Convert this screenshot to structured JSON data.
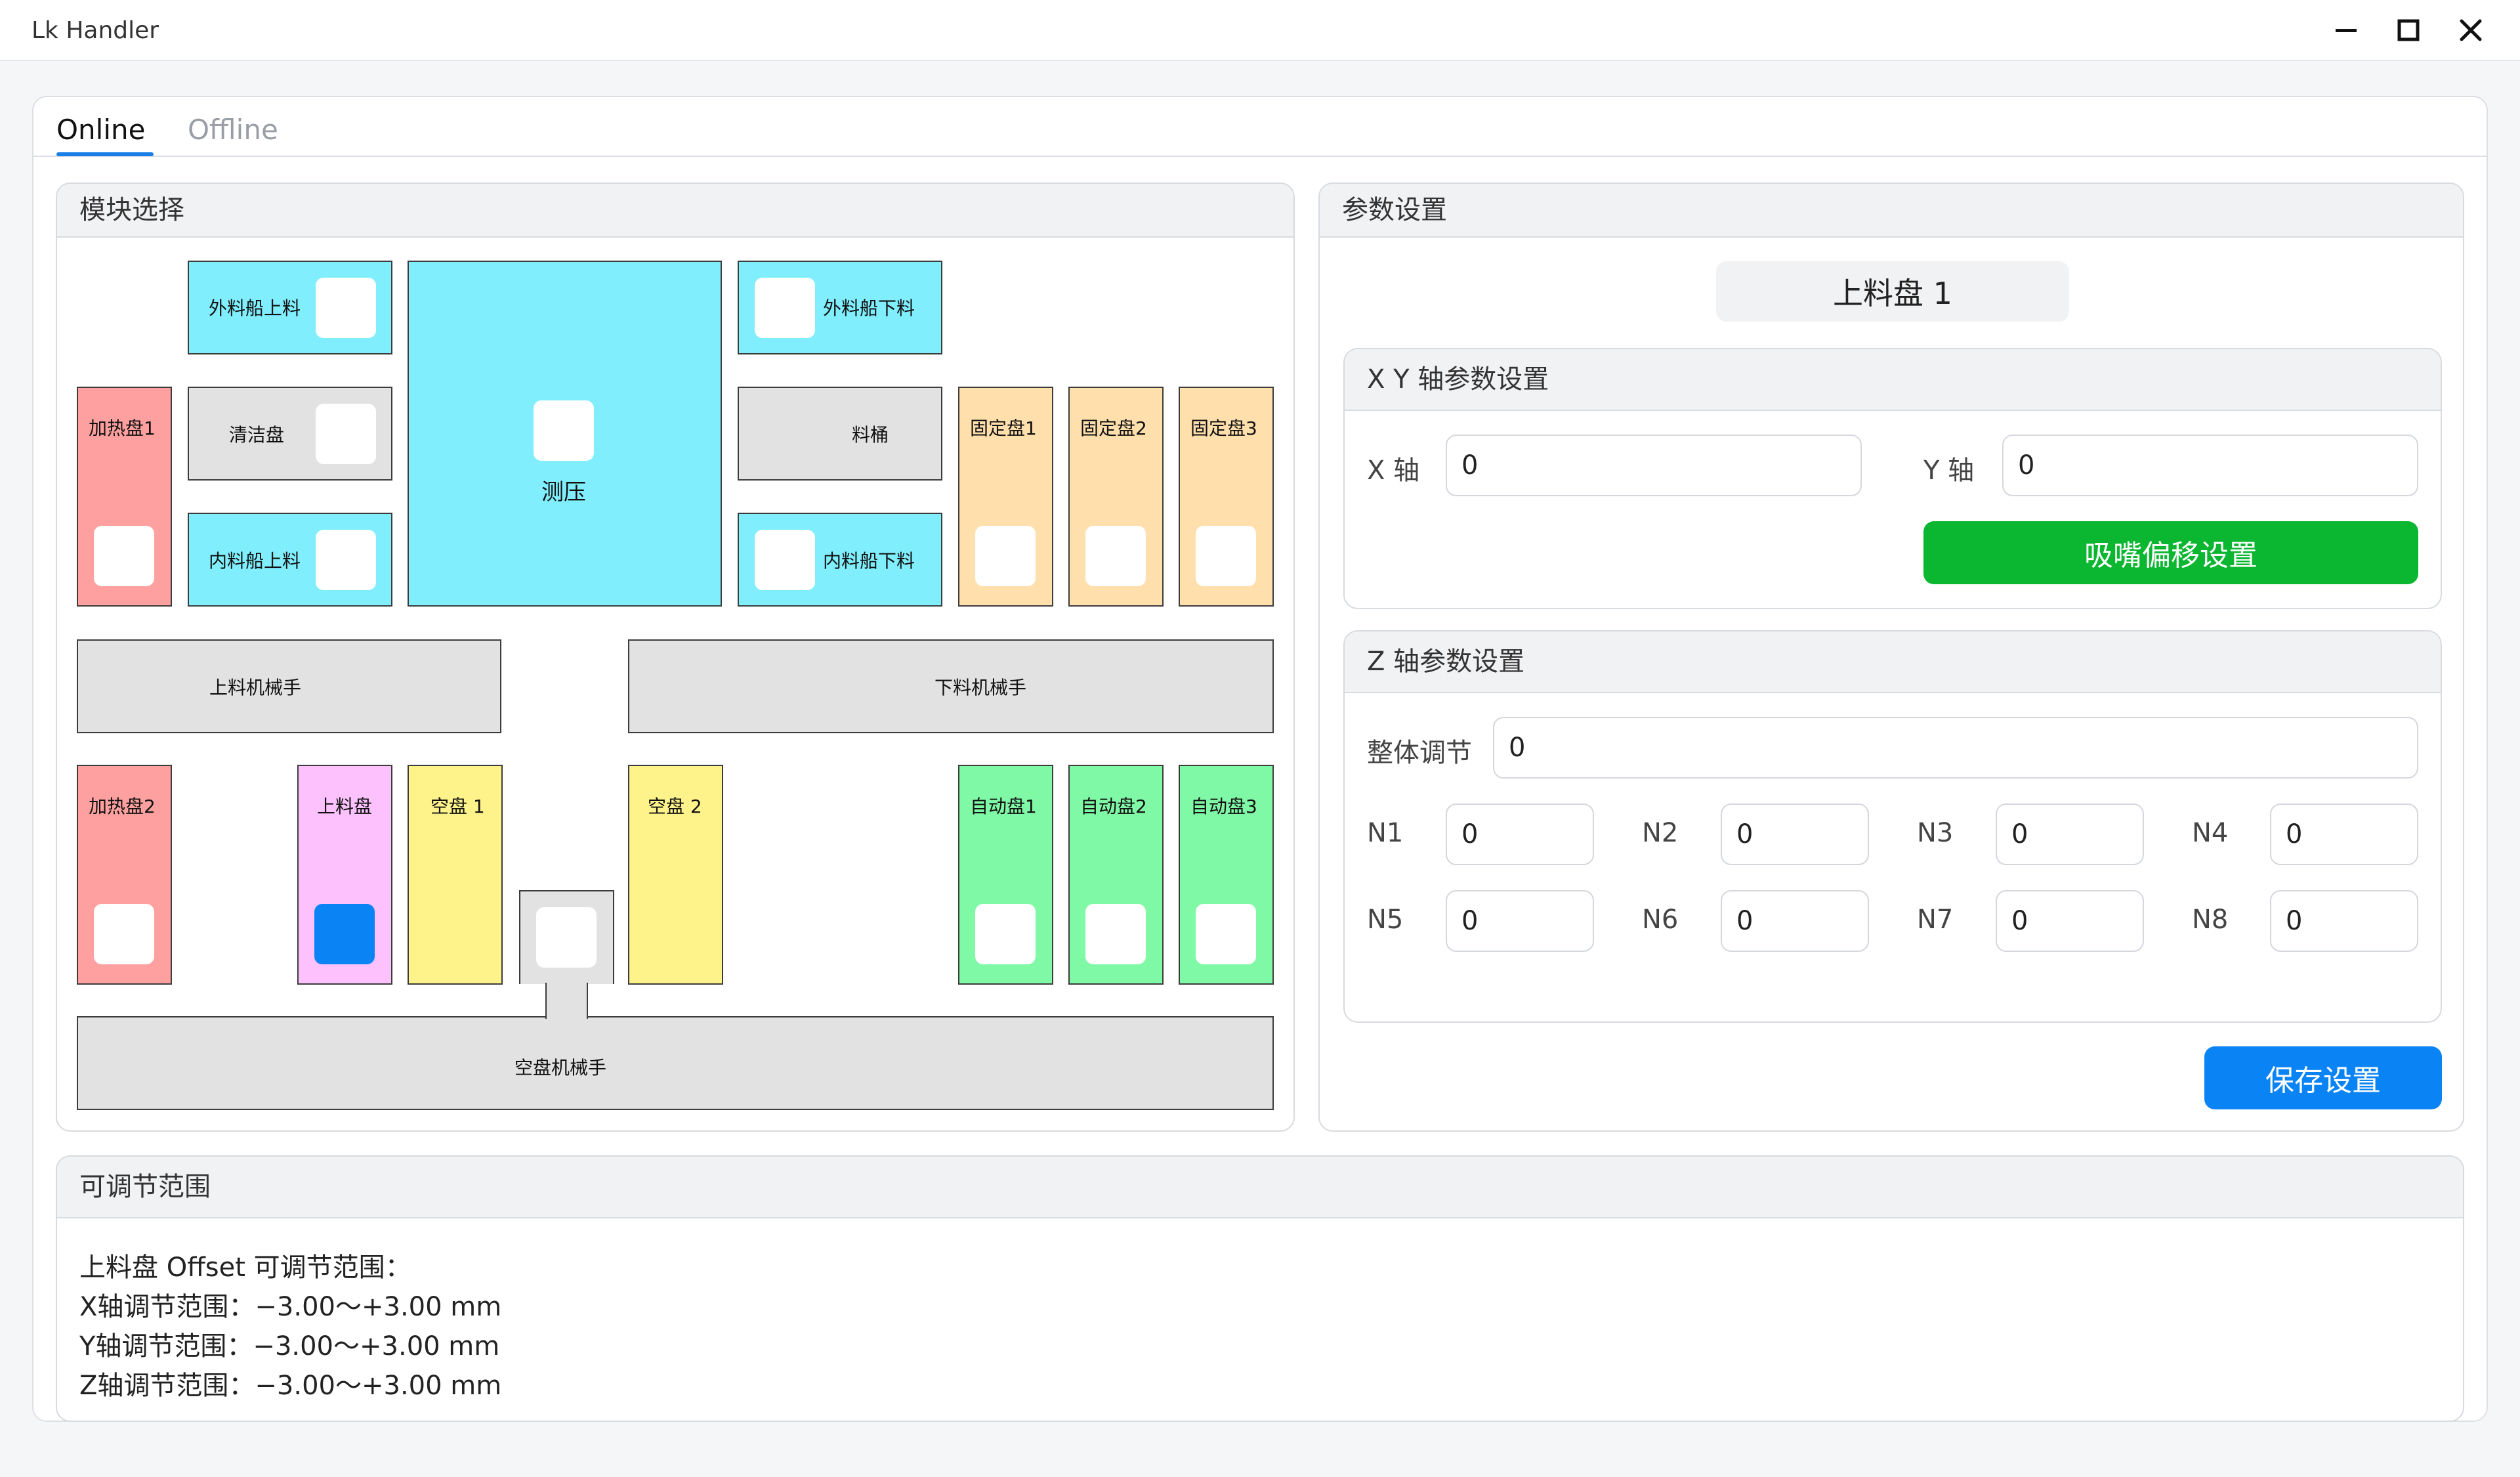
{
  "window": {
    "title": "Lk Handler",
    "minimize_icon": "minimize-icon",
    "maximize_icon": "maximize-icon",
    "close_icon": "close-icon"
  },
  "tabs": [
    {
      "label": "Online",
      "active": true
    },
    {
      "label": "Offline",
      "active": false
    }
  ],
  "module_panel": {
    "title": "模块选择",
    "modules": {
      "outer_boat_load": "外料船上料",
      "clean_tray": "清洁盘",
      "inner_boat_load": "内料船上料",
      "press_test": "测压",
      "outer_boat_unload": "外料船下料",
      "bin": "料桶",
      "inner_boat_unload": "内料船下料",
      "heat_tray_1": "加热盘1",
      "fixed_tray_1": "固定盘1",
      "fixed_tray_2": "固定盘2",
      "fixed_tray_3": "固定盘3",
      "load_robot": "上料机械手",
      "unload_robot": "下料机械手",
      "heat_tray_2": "加热盘2",
      "load_tray": "上料盘",
      "empty_tray_1": "空盘 1",
      "empty_tray_2": "空盘 2",
      "auto_tray_1": "自动盘1",
      "auto_tray_2": "自动盘2",
      "auto_tray_3": "自动盘3",
      "empty_tray_robot": "空盘机械手"
    },
    "colors": {
      "cyan": "#80eefc",
      "gray": "#e2e2e2",
      "red": "#fea0a0",
      "orange": "#ffdfac",
      "pink": "#fdc2fd",
      "yellow": "#fef28a",
      "green": "#80f9a6",
      "selected_slot": "#0a84f5"
    },
    "selected_module": "上料盘"
  },
  "param_panel": {
    "title": "参数设置",
    "current_module": "上料盘 1",
    "xy_group": {
      "title": "X Y  轴参数设置",
      "x_label": "X 轴",
      "x_value": "0",
      "y_label": "Y 轴",
      "y_value": "0",
      "nozzle_button": "吸嘴偏移设置",
      "nozzle_button_color": "#0bb631"
    },
    "z_group": {
      "title": "Z 轴参数设置",
      "overall_label": "整体调节",
      "overall_value": "0",
      "n_fields": [
        {
          "label": "N1",
          "value": "0"
        },
        {
          "label": "N2",
          "value": "0"
        },
        {
          "label": "N3",
          "value": "0"
        },
        {
          "label": "N4",
          "value": "0"
        },
        {
          "label": "N5",
          "value": "0"
        },
        {
          "label": "N6",
          "value": "0"
        },
        {
          "label": "N7",
          "value": "0"
        },
        {
          "label": "N8",
          "value": "0"
        }
      ]
    },
    "save_button": "保存设置",
    "save_button_color": "#0a84f5"
  },
  "range_panel": {
    "title": "可调节范围",
    "lines": [
      "上料盘 Offset 可调节范围：",
      "X轴调节范围：−3.00～+3.00 mm",
      "Y轴调节范围：−3.00～+3.00 mm",
      "Z轴调节范围：−3.00～+3.00 mm"
    ]
  }
}
